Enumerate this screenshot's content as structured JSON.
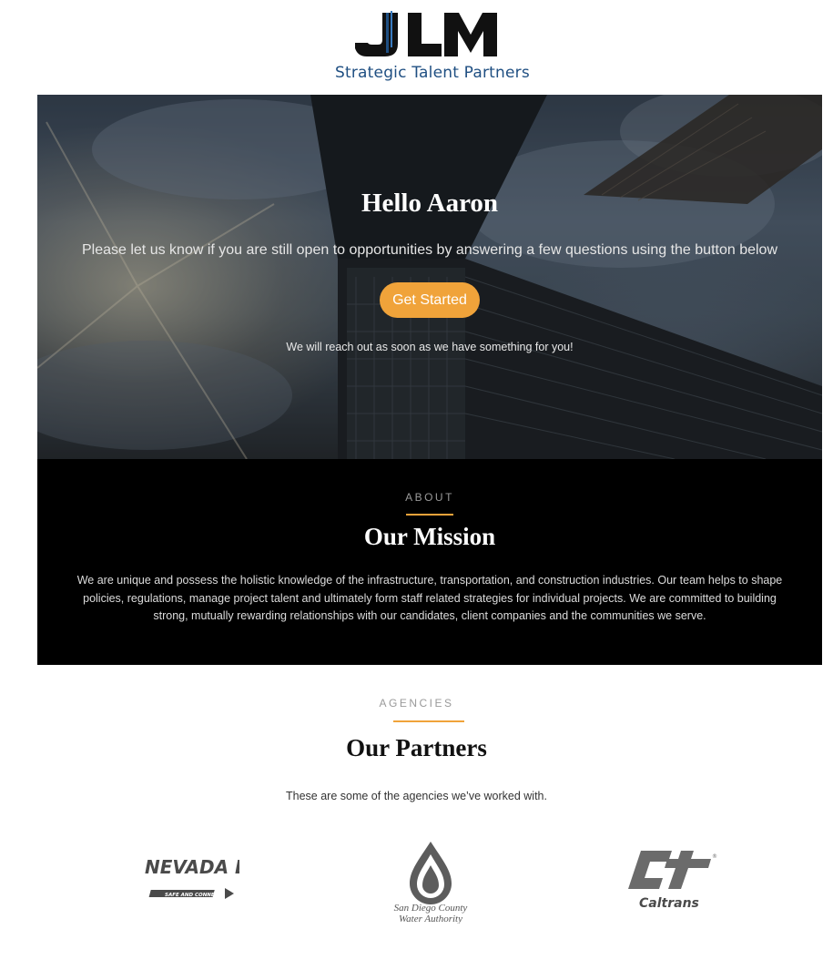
{
  "brand": {
    "logo_letters": "JLM",
    "tagline": "Strategic Talent Partners"
  },
  "hero": {
    "title": "Hello Aaron",
    "message": "Please let us know if you are still open to opportunities by answering a few questions using the button below",
    "cta_label": "Get Started",
    "note": "We will reach out as soon as we have something for you!"
  },
  "about": {
    "eyebrow": "ABOUT",
    "title": "Our Mission",
    "body": "We are unique and possess the holistic knowledge of the infrastructure, transportation, and construction industries. Our team helps to shape policies, regulations, manage project talent and ultimately form staff related strategies for individual projects. We are committed to building strong, mutually rewarding relationships with our candidates, client companies and the communities we serve."
  },
  "partners": {
    "eyebrow": "AGENCIES",
    "title": "Our Partners",
    "subtitle": "These are some of the agencies we’ve worked with.",
    "agencies": [
      {
        "name": "NEVADA DOT",
        "tagline": "SAFE AND CONNECTED",
        "icon": "nevada-dot-logo"
      },
      {
        "name": "San Diego County Water Authority",
        "line1": "San Diego County",
        "line2": "Water Authority",
        "icon": "water-drop-logo"
      },
      {
        "name": "Caltrans",
        "icon": "caltrans-logo"
      }
    ]
  },
  "colors": {
    "accent": "#f0a33a",
    "brand_blue": "#1f4f82",
    "about_bg": "#000000",
    "logo_gray": "#6b6b6b"
  }
}
